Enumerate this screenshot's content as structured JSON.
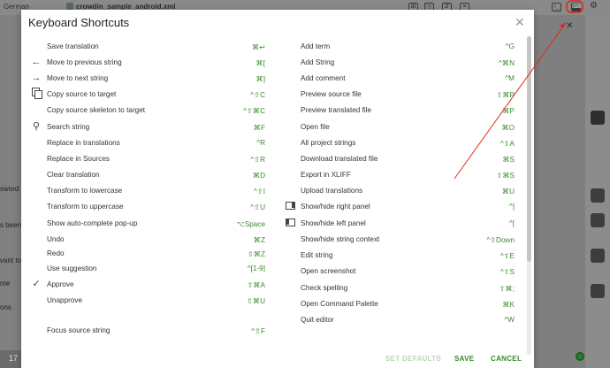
{
  "background": {
    "language": "German",
    "file_name": "crowdin_sample_android.xml",
    "left_fragments": [
      "sword",
      "s been",
      "vant to",
      "me",
      "ons"
    ],
    "bottom_number": "17"
  },
  "modal": {
    "title": "Keyboard Shortcuts",
    "close_icon": "close-icon",
    "left_shortcuts": [
      {
        "label": "Save translation",
        "key": "⌘↩",
        "icon": ""
      },
      {
        "label": "Move to previous string",
        "key": "⌘[",
        "icon": "arrow-left-icon"
      },
      {
        "label": "Move to next string",
        "key": "⌘]",
        "icon": "arrow-right-icon"
      },
      {
        "label": "Copy source to target",
        "key": "^⇧C",
        "icon": "copy-icon"
      },
      {
        "label": "Copy source skeleton to target",
        "key": "^⇧⌘C",
        "icon": ""
      },
      {
        "label": "Search string",
        "key": "⌘F",
        "icon": "search-icon"
      },
      {
        "label": "Replace in translations",
        "key": "^R",
        "icon": ""
      },
      {
        "label": "Replace in Sources",
        "key": "^⇧R",
        "icon": ""
      },
      {
        "label": "Clear translation",
        "key": "⌘D",
        "icon": ""
      },
      {
        "label": "Transform to lowercase",
        "key": "^⇧I",
        "icon": ""
      },
      {
        "label": "Transform to uppercase",
        "key": "^⇧U",
        "icon": ""
      },
      {
        "label": "Show auto-complete pop-up",
        "key": "⌥Space",
        "icon": ""
      },
      {
        "label": "Undo",
        "key": "⌘Z",
        "icon": ""
      },
      {
        "label": "Redo",
        "key": "⇧⌘Z",
        "icon": ""
      },
      {
        "label": "Use suggestion",
        "key": "^[1-9]",
        "icon": ""
      },
      {
        "label": "Approve",
        "key": "⇧⌘A",
        "icon": "check-icon"
      },
      {
        "label": "Unapprove",
        "key": "⇧⌘U",
        "icon": ""
      },
      {
        "label": "Focus source string",
        "key": "^⇧F",
        "icon": ""
      }
    ],
    "right_shortcuts": [
      {
        "label": "Add term",
        "key": "^G",
        "icon": ""
      },
      {
        "label": "Add String",
        "key": "^⌘N",
        "icon": ""
      },
      {
        "label": "Add comment",
        "key": "^M",
        "icon": ""
      },
      {
        "label": "Preview source file",
        "key": "⇧⌘P",
        "icon": ""
      },
      {
        "label": "Preview translated file",
        "key": "⌘P",
        "icon": ""
      },
      {
        "label": "Open file",
        "key": "⌘O",
        "icon": ""
      },
      {
        "label": "All project strings",
        "key": "^⇧A",
        "icon": ""
      },
      {
        "label": "Download translated file",
        "key": "⌘S",
        "icon": ""
      },
      {
        "label": "Export in XLIFF",
        "key": "⇧⌘S",
        "icon": ""
      },
      {
        "label": "Upload translations",
        "key": "⌘U",
        "icon": ""
      },
      {
        "label": "Show/hide right panel",
        "key": "^]",
        "icon": "right-panel-icon"
      },
      {
        "label": "Show/hide left panel",
        "key": "^[",
        "icon": "left-panel-icon"
      },
      {
        "label": "Show/hide string context",
        "key": "^⇧Down",
        "icon": ""
      },
      {
        "label": "Edit string",
        "key": "^⇧E",
        "icon": ""
      },
      {
        "label": "Open screenshot",
        "key": "^⇧S",
        "icon": ""
      },
      {
        "label": "Check spelling",
        "key": "⇧⌘;",
        "icon": ""
      },
      {
        "label": "Open Command Palette",
        "key": "⌘K",
        "icon": ""
      },
      {
        "label": "Quit editor",
        "key": "^W",
        "icon": ""
      }
    ],
    "footer": {
      "set_defaults": "SET DEFAULTS",
      "save": "SAVE",
      "cancel": "CANCEL"
    }
  },
  "colors": {
    "accent": "#3a8a2c",
    "annotation": "#e0281a"
  }
}
